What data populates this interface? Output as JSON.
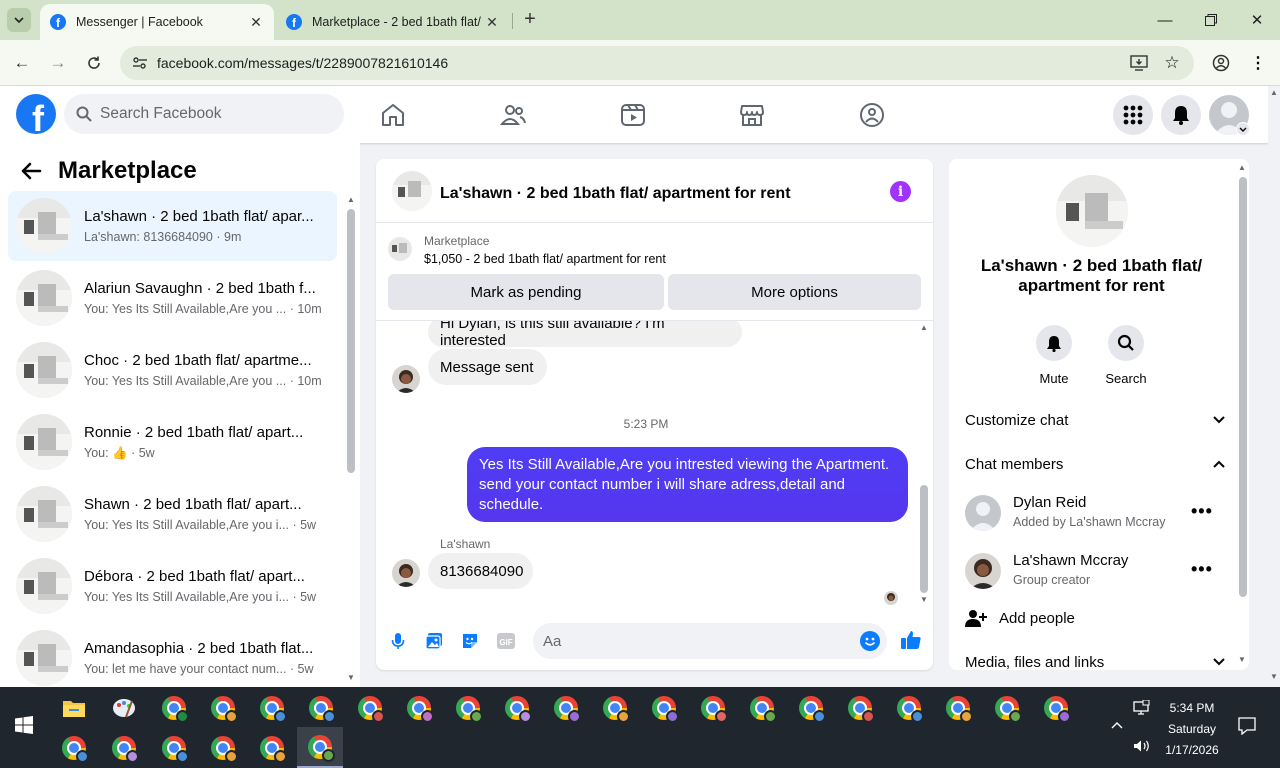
{
  "browser": {
    "tabs": [
      {
        "title": "Messenger | Facebook",
        "active": true
      },
      {
        "title": "Marketplace - 2 bed 1bath flat/",
        "active": false
      }
    ],
    "url": "facebook.com/messages/t/2289007821610146"
  },
  "fb": {
    "search_placeholder": "Search Facebook",
    "logo_letter": "f"
  },
  "left": {
    "title": "Marketplace",
    "conversations": [
      {
        "title": "La'shawn · 2 bed 1bath flat/ apar...",
        "subtitle": "La'shawn: 8136684090 · 9m",
        "active": true
      },
      {
        "title": "Alariun Savaughn · 2 bed 1bath f...",
        "subtitle": "You: Yes Its Still Available,Are you ... · 10m",
        "active": false
      },
      {
        "title": "Choc · 2 bed 1bath flat/ apartme...",
        "subtitle": "You: Yes Its Still Available,Are you ... · 10m",
        "active": false
      },
      {
        "title": "Ronnie · 2 bed 1bath flat/ apart...",
        "subtitle": "You: 👍 · 5w",
        "active": false
      },
      {
        "title": "Shawn · 2 bed 1bath flat/ apart...",
        "subtitle": "You: Yes Its Still Available,Are you i... · 5w",
        "active": false
      },
      {
        "title": "Débora · 2 bed 1bath flat/ apart...",
        "subtitle": "You: Yes Its Still Available,Are you i... · 5w",
        "active": false
      },
      {
        "title": "Amandasophia · 2 bed 1bath flat...",
        "subtitle": "You: let me have your contact num... · 5w",
        "active": false
      }
    ]
  },
  "chat": {
    "title": "La'shawn · 2 bed 1bath flat/ apartment for rent",
    "marketplace_label": "Marketplace",
    "listing": "$1,050 - 2 bed 1bath flat/ apartment for rent",
    "btn_pending": "Mark as pending",
    "btn_more": "More options",
    "msg_top": "Hi Dylan, is this still available? I'm interested",
    "msg_sent": "Message sent",
    "time_sep": "5:23 PM",
    "msg_me": "Yes Its Still Available,Are you intrested viewing the Apartment. send your contact number i will share adress,detail and schedule.",
    "sender_name": "La'shawn",
    "msg_number": "8136684090",
    "composer_placeholder": "Aa"
  },
  "right": {
    "title": "La'shawn · 2 bed 1bath flat/ apartment for rent",
    "mute": "Mute",
    "search": "Search",
    "customize": "Customize chat",
    "members_header": "Chat members",
    "members": [
      {
        "name": "Dylan Reid",
        "role": "Added by La'shawn Mccray"
      },
      {
        "name": "La'shawn Mccray",
        "role": "Group creator"
      }
    ],
    "add_people": "Add people",
    "media": "Media, files and links"
  },
  "taskbar": {
    "time": "5:34 PM",
    "day": "Saturday",
    "date": "1/17/2026"
  },
  "colors": {
    "accent": "#1877f2",
    "bubble_me": "#5636ee",
    "info": "#a033ff"
  }
}
